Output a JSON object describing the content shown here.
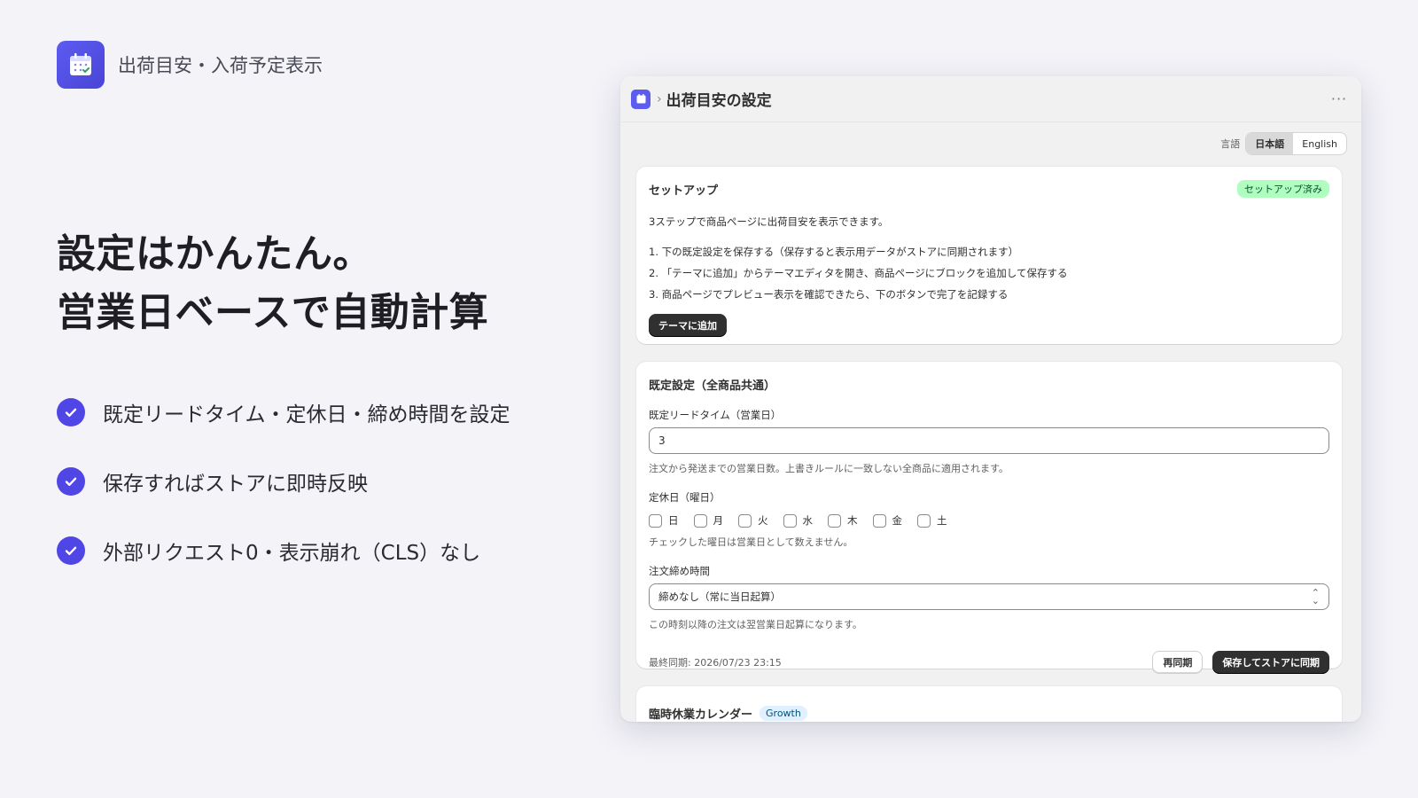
{
  "brand": {
    "name": "出荷目安・入荷予定表示",
    "logo_icon": "calendar-check-icon",
    "accent": "#4f46e5"
  },
  "headline": {
    "line1": "設定はかんたん。",
    "line2": "営業日ベースで自動計算"
  },
  "features": [
    {
      "label": "既定リードタイム・定休日・締め時間を設定"
    },
    {
      "label": "保存すればストアに即時反映"
    },
    {
      "label": "外部リクエスト0・表示崩れ（CLS）なし"
    }
  ],
  "window": {
    "breadcrumb_sep": "›",
    "title": "出荷目安の設定",
    "more_icon": "ellipsis-icon",
    "language": {
      "label": "言語",
      "options": [
        "日本語",
        "English"
      ],
      "selected": "日本語"
    }
  },
  "setup": {
    "title": "セットアップ",
    "badge": "セットアップ済み",
    "description": "3ステップで商品ページに出荷目安を表示できます。",
    "steps": [
      "1. 下の既定設定を保存する（保存すると表示用データがストアに同期されます）",
      "2. 「テーマに追加」からテーマエディタを開き、商品ページにブロックを追加して保存する",
      "3. 商品ページでプレビュー表示を確認できたら、下のボタンで完了を記録する"
    ],
    "add_to_theme_button": "テーマに追加"
  },
  "defaults": {
    "title": "既定設定（全商品共通）",
    "lead_time": {
      "label": "既定リードタイム（営業日）",
      "value": "3",
      "help": "注文から発送までの営業日数。上書きルールに一致しない全商品に適用されます。"
    },
    "holidays": {
      "label": "定休日（曜日）",
      "days": [
        "日",
        "月",
        "火",
        "水",
        "木",
        "金",
        "土"
      ],
      "checked": [
        false,
        false,
        false,
        false,
        false,
        false,
        false
      ],
      "help": "チェックした曜日は営業日として数えません。"
    },
    "cutoff": {
      "label": "注文締め時間",
      "selected": "締めなし（常に当日起算）",
      "help": "この時刻以降の注文は翌営業日起算になります。"
    },
    "last_synced": "最終同期: 2026/07/23 23:15",
    "resync_button": "再同期",
    "save_button": "保存してストアに同期"
  },
  "holiday_calendar": {
    "title": "臨時休業カレンダー",
    "badge": "Growth"
  }
}
